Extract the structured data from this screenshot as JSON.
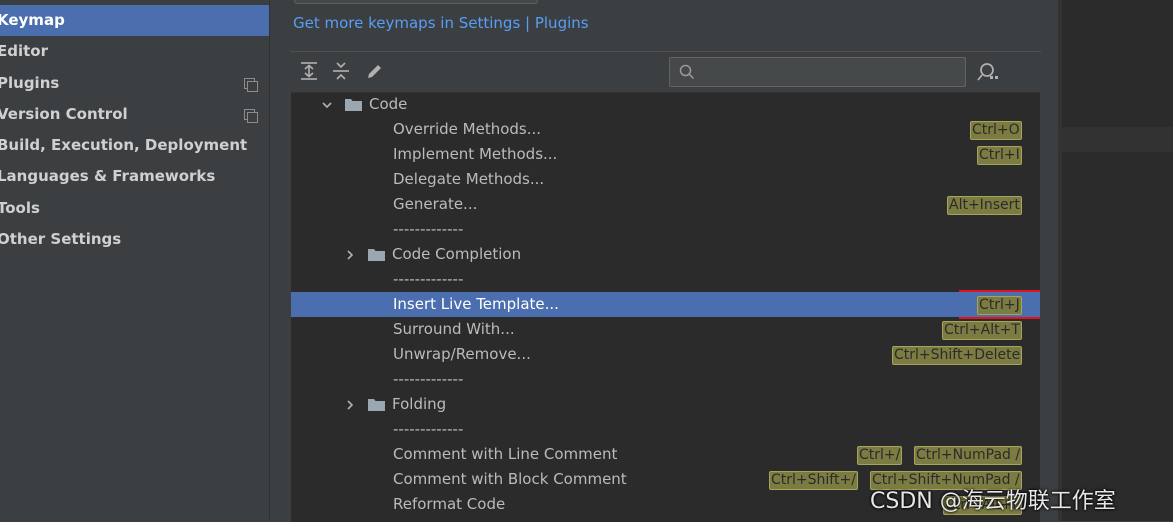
{
  "sidebar": {
    "items": [
      {
        "label": "Keymap",
        "active": true,
        "copy_icon": false
      },
      {
        "label": "Editor",
        "active": false,
        "copy_icon": false
      },
      {
        "label": "Plugins",
        "active": false,
        "copy_icon": true
      },
      {
        "label": "Version Control",
        "active": false,
        "copy_icon": true
      },
      {
        "label": "Build, Execution, Deployment",
        "active": false,
        "copy_icon": false
      },
      {
        "label": "Languages & Frameworks",
        "active": false,
        "copy_icon": false
      },
      {
        "label": "Tools",
        "active": false,
        "copy_icon": false
      },
      {
        "label": "Other Settings",
        "active": false,
        "copy_icon": false
      }
    ]
  },
  "main": {
    "link_text": "Get more keymaps in Settings | Plugins",
    "toolbar": {
      "expand_all_icon": "expand-all-icon",
      "collapse_all_icon": "collapse-all-icon",
      "edit_icon": "pencil-icon",
      "find_by_shortcut_icon": "find-by-shortcut-icon"
    },
    "search": {
      "placeholder": "",
      "value": ""
    }
  },
  "tree": {
    "rows": [
      {
        "label": "Code",
        "kind": "folder",
        "expanded": true
      },
      {
        "label": "Override Methods...",
        "kind": "action",
        "shortcuts": [
          "Ctrl+O"
        ]
      },
      {
        "label": "Implement Methods...",
        "kind": "action",
        "shortcuts": [
          "Ctrl+I"
        ]
      },
      {
        "label": "Delegate Methods...",
        "kind": "action",
        "shortcuts": []
      },
      {
        "label": "Generate...",
        "kind": "action",
        "shortcuts": [
          "Alt+Insert"
        ]
      },
      {
        "label": "-------------",
        "kind": "separator"
      },
      {
        "label": "Code Completion",
        "kind": "folder",
        "expanded": false
      },
      {
        "label": "-------------",
        "kind": "separator"
      },
      {
        "label": "Insert Live Template...",
        "kind": "action",
        "selected": true,
        "shortcuts": [
          "Ctrl+J"
        ]
      },
      {
        "label": "Surround With...",
        "kind": "action",
        "shortcuts": [
          "Ctrl+Alt+T"
        ]
      },
      {
        "label": "Unwrap/Remove...",
        "kind": "action",
        "shortcuts": [
          "Ctrl+Shift+Delete"
        ]
      },
      {
        "label": "-------------",
        "kind": "separator"
      },
      {
        "label": "Folding",
        "kind": "folder",
        "expanded": false
      },
      {
        "label": "-------------",
        "kind": "separator"
      },
      {
        "label": "Comment with Line Comment",
        "kind": "action",
        "shortcuts": [
          "Ctrl+/",
          "Ctrl+NumPad /"
        ]
      },
      {
        "label": "Comment with Block Comment",
        "kind": "action",
        "shortcuts": [
          "Ctrl+Shift+/",
          "Ctrl+Shift+NumPad /"
        ]
      },
      {
        "label": "Reformat Code",
        "kind": "action",
        "shortcuts": [
          "Ctrl+Alt+L"
        ]
      }
    ]
  },
  "watermark": "CSDN @海云物联工作室",
  "colors": {
    "selection": "#4b6eaf",
    "link": "#589df6",
    "shortcut_bg": "#7c7c42",
    "highlight_box": "#e0141a"
  }
}
